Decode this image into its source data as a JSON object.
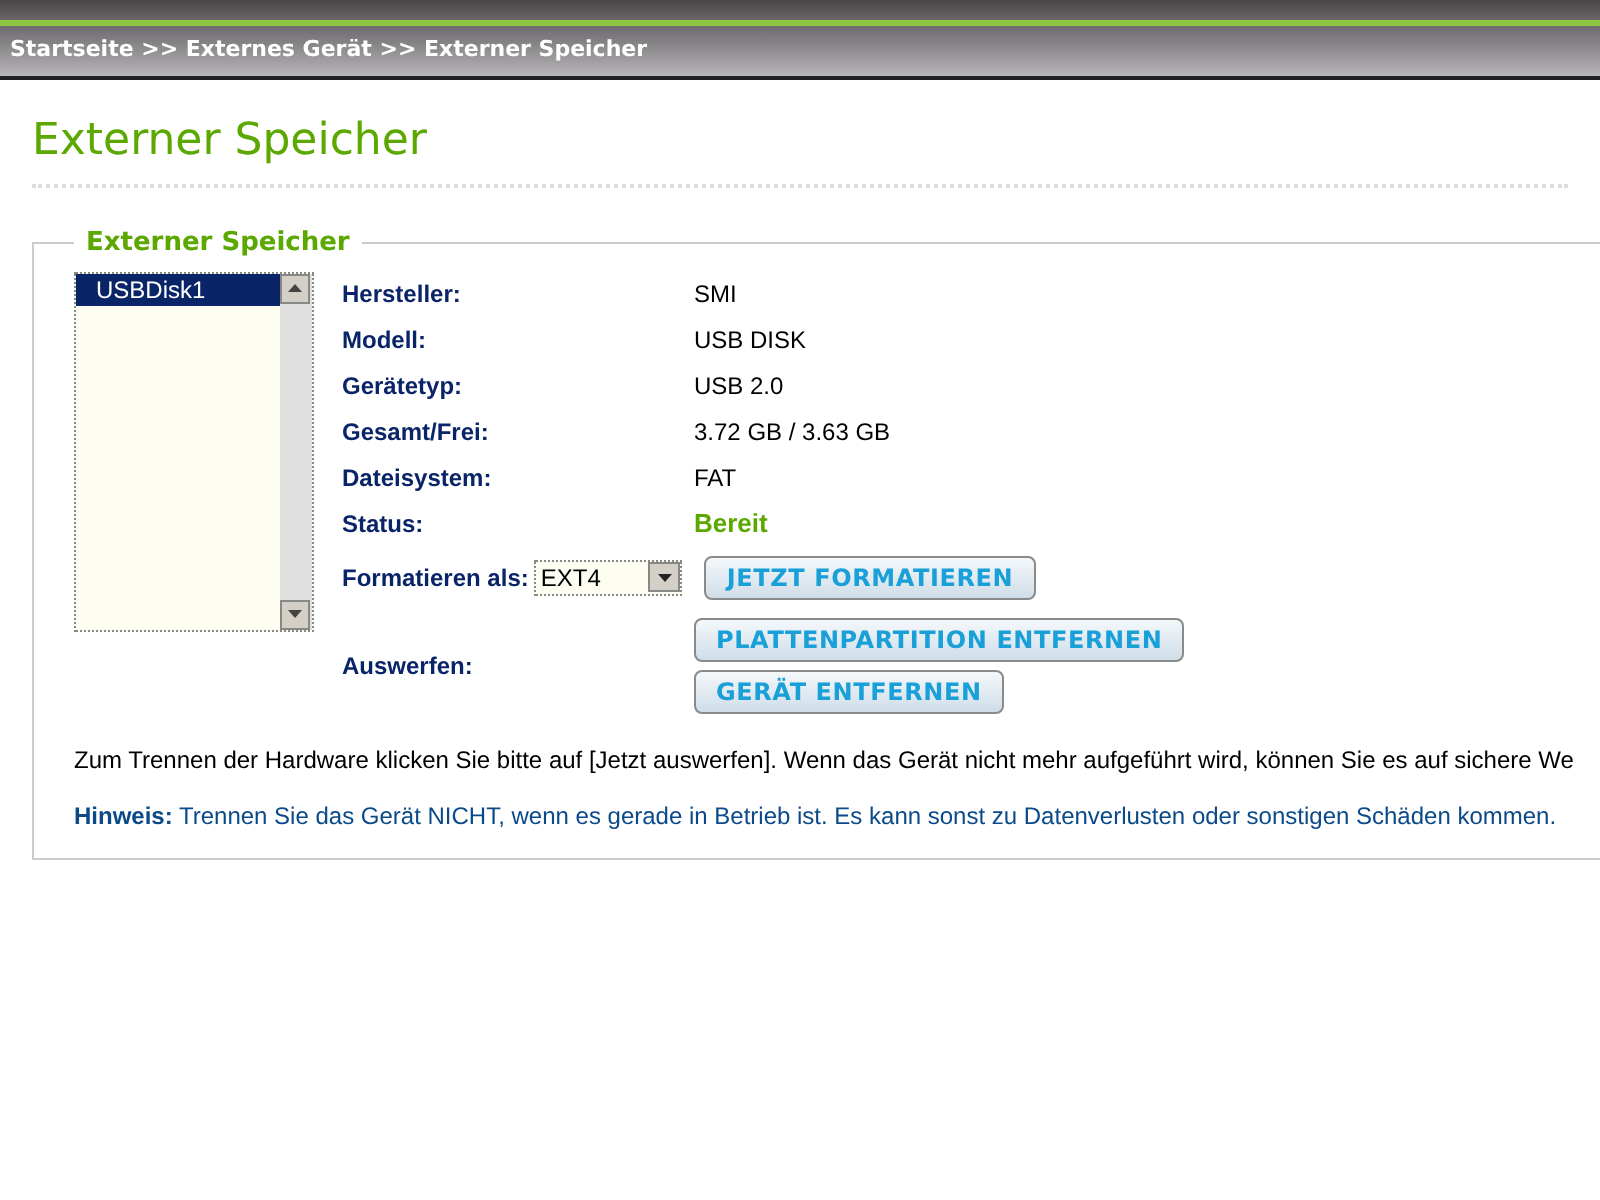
{
  "breadcrumb": "Startseite >> Externes Gerät >> Externer Speicher",
  "page_title": "Externer Speicher",
  "section_title": "Externer Speicher",
  "devices": [
    {
      "label": "USBDisk1",
      "selected": true
    }
  ],
  "properties": [
    {
      "label": "Hersteller:",
      "value": "SMI",
      "kind": "plain"
    },
    {
      "label": "Modell:",
      "value": "USB DISK",
      "kind": "plain"
    },
    {
      "label": "Gerätetyp:",
      "value": "USB 2.0",
      "kind": "plain"
    },
    {
      "label": "Gesamt/Frei:",
      "value": "3.72 GB / 3.63 GB",
      "kind": "plain"
    },
    {
      "label": "Dateisystem:",
      "value": "FAT",
      "kind": "plain"
    },
    {
      "label": "Status:",
      "value": "Bereit",
      "kind": "status"
    }
  ],
  "format": {
    "label": "Formatieren als:",
    "value": "EXT4",
    "button": "JETZT FORMATIEREN"
  },
  "eject": {
    "label": "Auswerfen:",
    "buttons": [
      "PLATTENPARTITION ENTFERNEN",
      "GERÄT ENTFERNEN"
    ]
  },
  "info_text": "Zum Trennen der Hardware klicken Sie bitte auf [Jetzt auswerfen]. Wenn das Gerät nicht mehr aufgeführt wird, können Sie es auf sichere We",
  "note": "**Hinweis:** Trennen Sie das Gerät NICHT, wenn es gerade in Betrieb ist. Es kann sonst zu Datenverlusten oder sonstigen Schäden kommen."
}
